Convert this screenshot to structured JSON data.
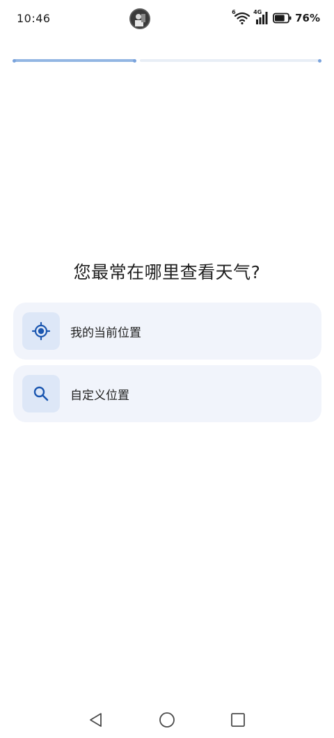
{
  "status_bar": {
    "time": "10:46",
    "network_type": "4G",
    "wifi_badge": "6",
    "battery_percent": "76%",
    "battery_level": 0.76
  },
  "progress": {
    "current_step": 1,
    "total_steps": 2
  },
  "onboarding": {
    "question": "您最常在哪里查看天气?",
    "options": [
      {
        "label": "我的当前位置",
        "icon": "my-location-icon"
      },
      {
        "label": "自定义位置",
        "icon": "search-icon"
      }
    ]
  },
  "colors": {
    "accent": "#1a56b0",
    "card_bg": "#f1f4fb",
    "icon_box_bg": "#dde7f7",
    "progress_fill": "#93b6e3"
  },
  "nav": {
    "back": "back-icon",
    "home": "home-icon",
    "recents": "recents-icon"
  }
}
